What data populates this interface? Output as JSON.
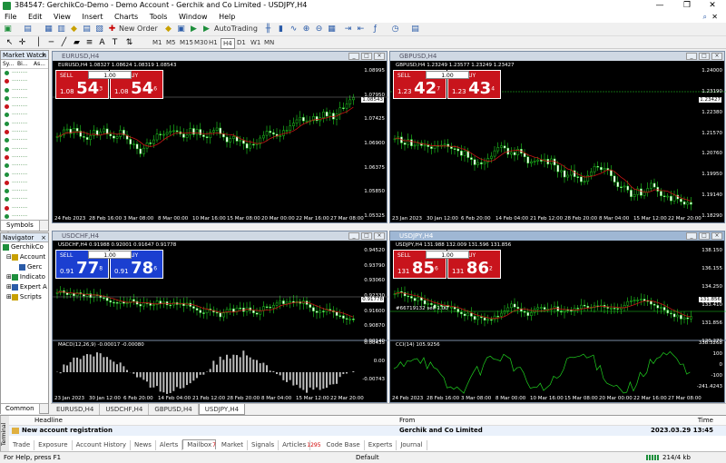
{
  "window": {
    "title": "384547: GerchikCo-Demo - Demo Account - Gerchik and Co Limited - USDJPY,H4"
  },
  "menu": [
    "File",
    "Edit",
    "View",
    "Insert",
    "Charts",
    "Tools",
    "Window",
    "Help"
  ],
  "toolbar": {
    "new_order": "New Order",
    "autotrading": "AutoTrading",
    "timeframes": [
      "M1",
      "M5",
      "M15",
      "M30",
      "H1",
      "H4",
      "D1",
      "W1",
      "MN"
    ],
    "active_tf": "H4"
  },
  "market_watch": {
    "title": "Market Watch",
    "col1": "Sy...",
    "col2": "Bi...",
    "col3": "As...",
    "row_count": 18,
    "tabs": [
      "Symbols",
      "Ti"
    ]
  },
  "navigator": {
    "title": "Navigator",
    "items": [
      "GerchikCo",
      "Account",
      "Gerc",
      "Indicato",
      "Expert A",
      "Scripts"
    ],
    "tabs": [
      "Common",
      "Fa"
    ]
  },
  "charts": [
    {
      "id": "eurusd",
      "title": "EURUSD,H4",
      "info": "EURUSD,H4  1.08327 1.08624 1.08319 1.08543",
      "lot": "1.00",
      "sell_label": "SELL",
      "buy_label": "BUY",
      "sell_small": "1.08",
      "sell_big": "54",
      "sell_sup": "3",
      "buy_small": "1.08",
      "buy_big": "54",
      "buy_sup": "6",
      "color": "red",
      "yticks": [
        "1.08995",
        "1.07950",
        "1.07425",
        "1.06900",
        "1.06375",
        "1.05850",
        "1.05325"
      ],
      "price_label": "1.08543",
      "xticks": [
        "24 Feb 2023",
        "28 Feb 16:00",
        "3 Mar 08:00",
        "8 Mar 00:00",
        "10 Mar 16:00",
        "15 Mar 08:00",
        "20 Mar 00:00",
        "22 Mar 16:00",
        "27 Mar 08:00"
      ]
    },
    {
      "id": "gbpusd",
      "title": "GBPUSD,H4",
      "info": "GBPUSD,H4  1.23249 1.23577 1.23249 1.23427",
      "lot": "1.00",
      "sell_label": "SELL",
      "buy_label": "BUY",
      "sell_small": "1.23",
      "sell_big": "42",
      "sell_sup": "7",
      "buy_small": "1.23",
      "buy_big": "43",
      "buy_sup": "4",
      "color": "red",
      "yticks": [
        "1.24000",
        "1.23190",
        "1.22380",
        "1.21570",
        "1.20760",
        "1.19950",
        "1.19140",
        "1.18290"
      ],
      "price_label": "1.23427",
      "xticks": [
        "23 Jan 2023",
        "30 Jan 12:00",
        "6 Feb 20:00",
        "14 Feb 04:00",
        "21 Feb 12:00",
        "28 Feb 20:00",
        "8 Mar 04:00",
        "15 Mar 12:00",
        "22 Mar 20:00"
      ]
    },
    {
      "id": "usdchf",
      "title": "USDCHF,H4",
      "info": "USDCHF,H4  0.91988 0.92001 0.91647 0.91778",
      "lot": "1.00",
      "sell_label": "SELL",
      "buy_label": "BUY",
      "sell_small": "0.91",
      "sell_big": "77",
      "sell_sup": "8",
      "buy_small": "0.91",
      "buy_big": "78",
      "buy_sup": "6",
      "color": "blue",
      "yticks": [
        "0.94520",
        "0.93790",
        "0.93060",
        "0.92330",
        "0.91600",
        "0.90870",
        "0.90140"
      ],
      "price_label": "0.91778",
      "macd_label": "MACD(12,26,9) -0.00017 -0.00080",
      "macd_ticks": [
        "0.00435",
        "0.00",
        "-0.00743"
      ],
      "xticks": [
        "23 Jan 2023",
        "30 Jan 12:00",
        "6 Feb 20:00",
        "14 Feb 04:00",
        "21 Feb 12:00",
        "28 Feb 20:00",
        "8 Mar 04:00",
        "15 Mar 12:00",
        "22 Mar 20:00"
      ]
    },
    {
      "id": "usdjpy",
      "title": "USDJPY,H4",
      "info": "USDJPY,H4  131.988 132.009 131.596 131.856",
      "lot": "1.00",
      "sell_label": "SELL",
      "buy_label": "BUY",
      "sell_small": "131",
      "sell_big": "85",
      "sell_sup": "6",
      "buy_small": "131",
      "buy_big": "86",
      "buy_sup": "2",
      "color": "red",
      "yticks": [
        "138.150",
        "136.155",
        "134.250",
        "133.410",
        "131.856",
        "120.270"
      ],
      "price_label": "131.856",
      "order_line": "#66719132 sell 1.00",
      "cci_label": "CCI(14) 105.9256",
      "cci_ticks": [
        "338.3268",
        "100",
        "0",
        "-100",
        "-241.4243"
      ],
      "xticks": [
        "24 Feb 2023",
        "28 Feb 16:00",
        "3 Mar 08:00",
        "8 Mar 00:00",
        "10 Mar 16:00",
        "15 Mar 08:00",
        "20 Mar 00:00",
        "22 Mar 16:00",
        "27 Mar 08:00"
      ]
    }
  ],
  "chart_tabs": [
    "EURUSD,H4",
    "USDCHF,H4",
    "GBPUSD,H4",
    "USDJPY,H4"
  ],
  "chart_tab_active": "USDJPY,H4",
  "terminal": {
    "vert_label": "Terminal",
    "headline_col": "Headline",
    "from_col": "From",
    "time_col": "Time",
    "row_headline": "New account registration",
    "row_from": "Gerchik and Co Limited",
    "row_time": "2023.03.29 13:45",
    "tabs": [
      {
        "label": "Trade"
      },
      {
        "label": "Exposure"
      },
      {
        "label": "Account History"
      },
      {
        "label": "News"
      },
      {
        "label": "Alerts"
      },
      {
        "label": "Mailbox",
        "badge": "7"
      },
      {
        "label": "Market"
      },
      {
        "label": "Signals"
      },
      {
        "label": "Articles",
        "badge": "1295"
      },
      {
        "label": "Code Base"
      },
      {
        "label": "Experts"
      },
      {
        "label": "Journal"
      }
    ],
    "active_tab": "Mailbox"
  },
  "status": {
    "left": "For Help, press F1",
    "mid": "Default",
    "right": "214/4 kb"
  }
}
